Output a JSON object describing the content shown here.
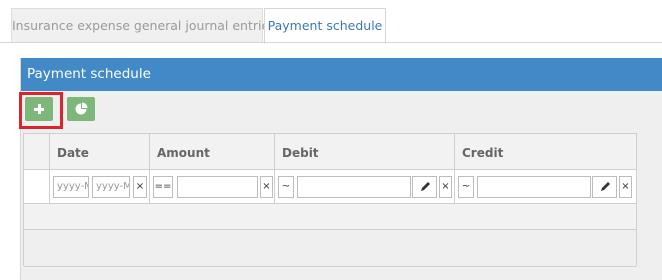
{
  "tabs": [
    {
      "label": "Insurance expense general journal entries",
      "active": false
    },
    {
      "label": "Payment schedule",
      "active": true
    }
  ],
  "panel": {
    "title": "Payment schedule",
    "toolbar": {
      "add_icon": "plus-icon",
      "chart_icon": "pie-chart-icon"
    }
  },
  "grid": {
    "columns": [
      "Date",
      "Amount",
      "Debit",
      "Credit"
    ],
    "filters": {
      "date_from_placeholder": "yyyy-MM-dd",
      "date_to_placeholder": "yyyy-MM-dd",
      "clear": "×",
      "amount_operator": "==",
      "debit_operator": "~",
      "credit_operator": "~"
    }
  },
  "colors": {
    "header_blue": "#4189c7",
    "button_green": "#7db87a",
    "highlight_red": "#d9262c",
    "active_tab_text": "#3b78b5"
  }
}
